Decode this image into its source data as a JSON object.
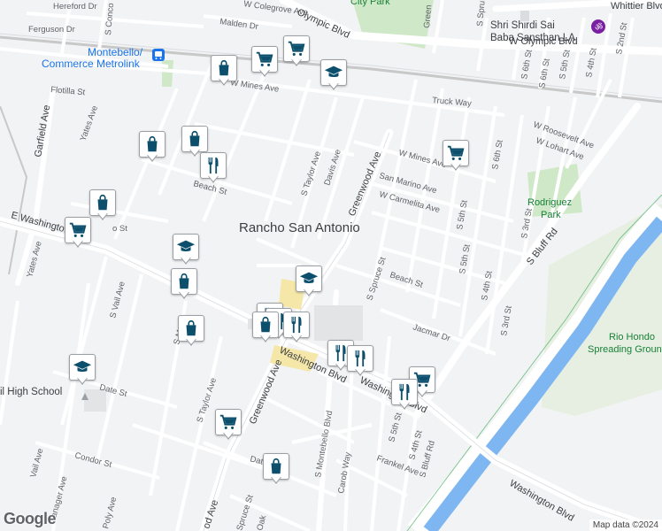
{
  "map": {
    "area_label": "Rancho San Antonio",
    "transit_label_line1": "Montebello/",
    "transit_label_line2": "Commerce Metrolink",
    "poi_label_temple_line1": "Shri Shirdi Sai",
    "poi_label_temple_line2": "Baba Sansthan LA",
    "poi_label_highschool": "il High School",
    "park_labels": {
      "rodriguez_1": "Rodriguez",
      "rodriguez_2": "Park",
      "rio_1": "Rio Hondo",
      "rio_2": "Spreading Grounds",
      "city_park": "City Park"
    },
    "streets": {
      "hereford": "Hereford Dr",
      "ferguson": "Ferguson Dr",
      "malden": "Malden Dr",
      "colegrove": "W Colegrove Ave",
      "olympic1": "Olympic Blvd",
      "olympic2": "W Olympic Blvd",
      "whittier": "Whittier Blvd",
      "flotilla": "Flotilla St",
      "mines1": "W Mines Ave",
      "mines2": "W Mines Ave",
      "truck": "Truck Way",
      "garfield": "Garfield Ave",
      "yates1": "Yates Ave",
      "yates2": "Yates Ave",
      "washington1": "E Washington Blvd",
      "washington2": "Washington Blvd",
      "washington3": "Washington Blvd",
      "washington4": "Washington Blvd",
      "taylor1": "S Taylor Ave",
      "taylor2": "S Taylor Ave",
      "davis": "Davis Ave",
      "greenwood1": "Greenwood Ave",
      "greenwood2": "Greenwood Ave",
      "greenwood3": "od Ave",
      "sanmarino": "San Marino Ave",
      "carmelita": "W Carmelita Ave",
      "roosevelt": "W Roosevelt Ave",
      "lohart": "W Lohart Ave",
      "beach1": "Beach St",
      "beach2": "Beach St",
      "spruce1": "S Spruce St",
      "spruce2": "Spruce St",
      "jacmar": "Jacmar Dr",
      "vail1": "S Vail Ave",
      "vail2": "Vail Ave",
      "date1": "Date St",
      "date2": "Date",
      "condor": "Condor St",
      "tanager": "Tanager Ave",
      "montebello": "S Montebello Blvd",
      "carob": "Carob Way",
      "frankel": "Frankel Ave",
      "fifth1": "S 5th St",
      "fifth2": "S 5th St",
      "fifth3": "S 5th St",
      "fifth4": "S 5th St",
      "fourth1": "S 4th St",
      "fourth2": "S 4th St",
      "fourth3": "S 4th St",
      "third1": "S 3rd St",
      "third2": "S 3rd St",
      "second": "S 2nd St",
      "sixth1": "S 6th St",
      "sixth2": "S 6th St",
      "bluff1": "S Bluff Rd",
      "bluff2": "S Bluff Rd",
      "conc": "S Conco",
      "spru_top": "S Spru",
      "green_top": "Green",
      "oak": "Oak",
      "poly": "Poly Ave",
      "sm": "S M",
      "to_st": "o St",
      "sixth_top": "S 6th St"
    },
    "attribution": "Map data ©2024",
    "google_logo": "Google"
  },
  "markers": [
    {
      "type": "shopping-bag-icon"
    },
    {
      "type": "shopping-cart-icon"
    },
    {
      "type": "shopping-cart-icon"
    },
    {
      "type": "graduation-cap-icon"
    },
    {
      "type": "shopping-bag-icon"
    },
    {
      "type": "shopping-bag-icon"
    },
    {
      "type": "restaurant-icon"
    },
    {
      "type": "shopping-bag-icon"
    },
    {
      "type": "shopping-cart-icon"
    },
    {
      "type": "shopping-cart-icon"
    },
    {
      "type": "graduation-cap-icon"
    },
    {
      "type": "shopping-bag-icon"
    },
    {
      "type": "graduation-cap-icon"
    },
    {
      "type": "restaurant-icon"
    },
    {
      "type": "restaurant-icon"
    },
    {
      "type": "restaurant-icon"
    },
    {
      "type": "shopping-bag-icon"
    },
    {
      "type": "restaurant-icon"
    },
    {
      "type": "restaurant-icon"
    },
    {
      "type": "graduation-cap-icon"
    },
    {
      "type": "shopping-cart-icon"
    },
    {
      "type": "restaurant-icon"
    },
    {
      "type": "shopping-cart-icon"
    },
    {
      "type": "shopping-bag-icon"
    },
    {
      "type": "shopping-bag-icon"
    }
  ],
  "colors": {
    "icon": "#0b4f6c",
    "park": "#cfe8c7",
    "water": "#7eb6f1",
    "rail": "#c8c8c8"
  }
}
